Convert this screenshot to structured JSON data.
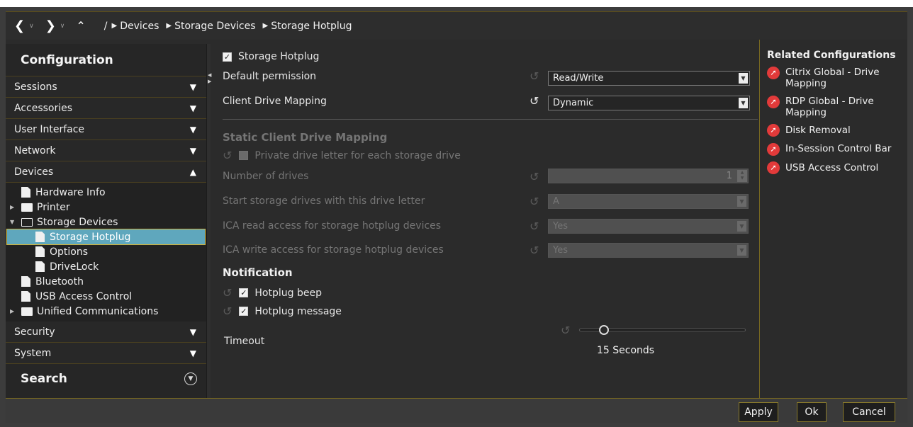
{
  "toolbar": {
    "back_icon": "chevron-left",
    "forward_icon": "chevron-right",
    "up_icon": "chevron-up",
    "root": "/",
    "breadcrumbs": [
      "Devices",
      "Storage Devices",
      "Storage Hotplug"
    ]
  },
  "sidebar": {
    "title": "Configuration",
    "sections_top": [
      {
        "label": "Sessions",
        "state": "collapsed"
      },
      {
        "label": "Accessories",
        "state": "collapsed"
      },
      {
        "label": "User Interface",
        "state": "collapsed"
      },
      {
        "label": "Network",
        "state": "collapsed"
      },
      {
        "label": "Devices",
        "state": "expanded"
      }
    ],
    "tree": [
      {
        "label": "Hardware Info",
        "type": "file"
      },
      {
        "label": "Printer",
        "type": "folder"
      },
      {
        "label": "Storage Devices",
        "type": "folder-open"
      },
      {
        "label": "Storage Hotplug",
        "type": "file",
        "selected": true
      },
      {
        "label": "Options",
        "type": "file"
      },
      {
        "label": "DriveLock",
        "type": "file"
      },
      {
        "label": "Bluetooth",
        "type": "file"
      },
      {
        "label": "USB Access Control",
        "type": "file"
      },
      {
        "label": "Unified Communications",
        "type": "folder"
      }
    ],
    "sections_bottom": [
      {
        "label": "Security",
        "state": "collapsed"
      },
      {
        "label": "System",
        "state": "collapsed"
      }
    ],
    "search_label": "Search"
  },
  "main": {
    "storage_hotplug": {
      "label": "Storage Hotplug",
      "checked": true
    },
    "default_permission": {
      "label": "Default permission",
      "value": "Read/Write"
    },
    "client_drive_mapping": {
      "label": "Client Drive Mapping",
      "value": "Dynamic"
    },
    "static_heading": "Static Client Drive Mapping",
    "private_drive": {
      "label": "Private drive letter for each storage drive",
      "checked": false
    },
    "number_of_drives": {
      "label": "Number of drives",
      "value": "1"
    },
    "start_letter": {
      "label": "Start storage drives with this drive letter",
      "value": "A"
    },
    "ica_read": {
      "label": "ICA read access for storage hotplug devices",
      "value": "Yes"
    },
    "ica_write": {
      "label": "ICA write access for storage hotplug devices",
      "value": "Yes"
    },
    "notification_heading": "Notification",
    "hotplug_beep": {
      "label": "Hotplug beep",
      "checked": true
    },
    "hotplug_message": {
      "label": "Hotplug message",
      "checked": true
    },
    "timeout": {
      "label": "Timeout",
      "value_text": "15 Seconds",
      "slider_fraction": 0.15
    }
  },
  "related": {
    "title": "Related Configurations",
    "items": [
      "Citrix Global - Drive Mapping",
      "RDP Global - Drive Mapping",
      "Disk Removal",
      "In-Session Control Bar",
      "USB Access Control"
    ]
  },
  "footer": {
    "apply": "Apply",
    "ok": "Ok",
    "cancel": "Cancel"
  },
  "colors": {
    "selection": "#5fa7bd",
    "accent_border": "#d4b43a",
    "link_icon": "#e23a3a"
  }
}
